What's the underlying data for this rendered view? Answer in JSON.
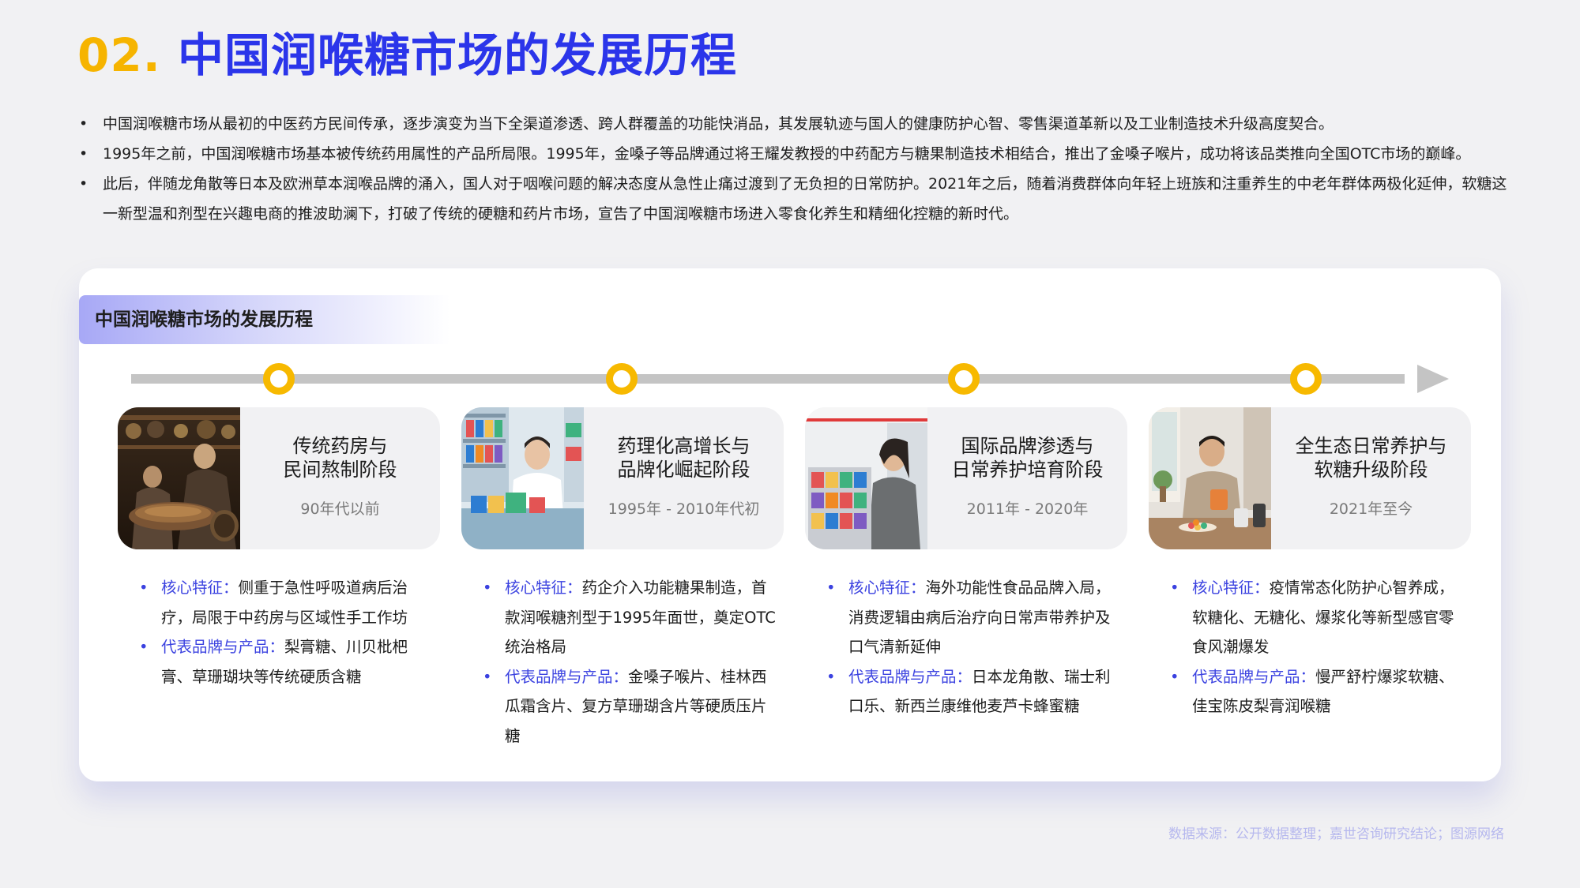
{
  "header": {
    "number": "02.",
    "title": "中国润喉糖市场的发展历程"
  },
  "intro": [
    "中国润喉糖市场从最初的中医药方民间传承，逐步演变为当下全渠道渗透、跨人群覆盖的功能快消品，其发展轨迹与国人的健康防护心智、零售渠道革新以及工业制造技术升级高度契合。",
    "1995年之前，中国润喉糖市场基本被传统药用属性的产品所局限。1995年，金嗓子等品牌通过将王耀发教授的中药配方与糖果制造技术相结合，推出了金嗓子喉片，成功将该品类推向全国OTC市场的巅峰。",
    "此后，伴随龙角散等日本及欧洲草本润喉品牌的涌入，国人对于咽喉问题的解决态度从急性止痛过渡到了无负担的日常防护。2021年之后，随着消费群体向年轻上班族和注重养生的中老年群体两极化延伸，软糖这一新型温和剂型在兴趣电商的推波助澜下，打破了传统的硬糖和药片市场，宣告了中国润喉糖市场进入零食化养生和精细化控糖的新时代。"
  ],
  "panel": {
    "heading": "中国润喉糖市场的发展历程"
  },
  "stages": [
    {
      "title_line1": "传统药房与",
      "title_line2": "民间熬制阶段",
      "period": "90年代以前",
      "feature_key": "核心特征：",
      "feature_text": "侧重于急性呼吸道病后治疗，局限于中药房与区域性手工作坊",
      "brands_key": "代表品牌与产品：",
      "brands_text": "梨膏糖、川贝枇杷膏、草珊瑚块等传统硬质含糖"
    },
    {
      "title_line1": "药理化高增长与",
      "title_line2": "品牌化崛起阶段",
      "period": "1995年 - 2010年代初",
      "feature_key": "核心特征：",
      "feature_text": "药企介入功能糖果制造，首款润喉糖剂型于1995年面世，奠定OTC统治格局",
      "brands_key": "代表品牌与产品：",
      "brands_text": "金嗓子喉片、桂林西瓜霜含片、复方草珊瑚含片等硬质压片糖"
    },
    {
      "title_line1": "国际品牌渗透与",
      "title_line2": "日常养护培育阶段",
      "period": "2011年 - 2020年",
      "feature_key": "核心特征：",
      "feature_text": "海外功能性食品品牌入局，消费逻辑由病后治疗向日常声带养护及口气清新延伸",
      "brands_key": "代表品牌与产品：",
      "brands_text": "日本龙角散、瑞士利口乐、新西兰康维他麦芦卡蜂蜜糖"
    },
    {
      "title_line1": "全生态日常养护与",
      "title_line2": "软糖升级阶段",
      "period": "2021年至今",
      "feature_key": "核心特征：",
      "feature_text": "疫情常态化防护心智养成，软糖化、无糖化、爆浆化等新型感官零食风潮爆发",
      "brands_key": "代表品牌与产品：",
      "brands_text": "慢严舒柠爆浆软糖、佳宝陈皮梨膏润喉糖"
    }
  ],
  "footer": {
    "source": "数据来源：公开数据整理；嘉世咨询研究结论；图源网络"
  },
  "colors": {
    "accent_blue": "#2b35ea",
    "accent_yellow": "#f6b400",
    "timeline_gray": "#c4c4c4",
    "source_text": "#b6b8ee"
  }
}
